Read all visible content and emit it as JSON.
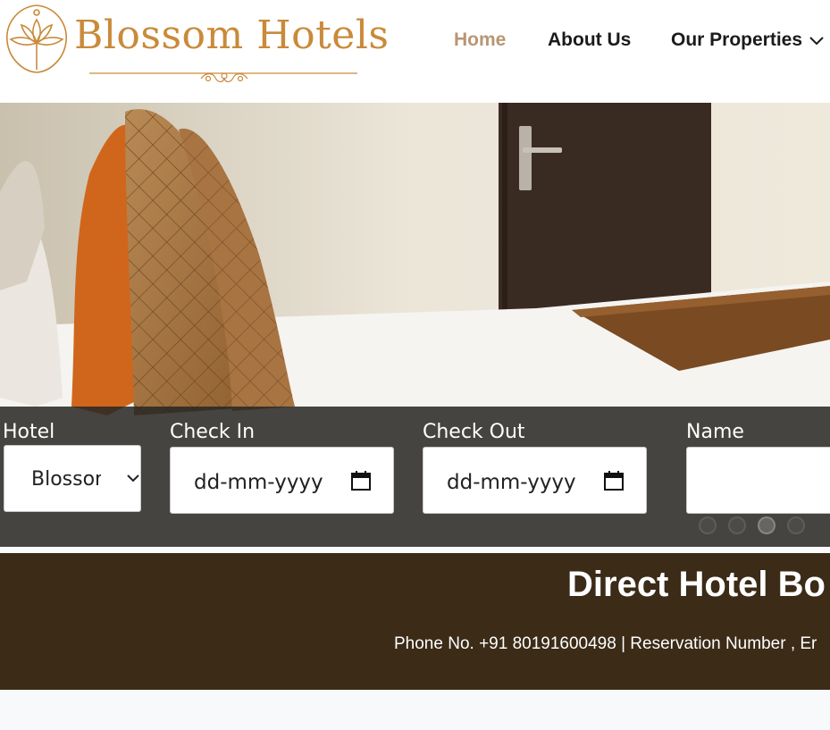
{
  "brand": {
    "name": "Blossom Hotels",
    "accent_color": "#c98a3a",
    "logo_icon": "lotus-icon"
  },
  "nav": {
    "items": [
      {
        "label": "Home",
        "active": true,
        "color": "#b99573"
      },
      {
        "label": "About Us",
        "active": false
      },
      {
        "label": "Our Properties",
        "active": false,
        "has_dropdown": true
      }
    ],
    "dropdown_icon": "chevron-down-icon"
  },
  "hero": {
    "slides_count": 4,
    "active_slide": 3
  },
  "booking": {
    "hotel_label": "Hotel",
    "hotel_selected": "Blossom",
    "checkin_label": "Check In",
    "checkin_value": "dd-mm-yyyy",
    "checkout_label": "Check Out",
    "checkout_value": "dd-mm-yyyy",
    "name_label": "Name",
    "name_value": "",
    "calendar_icon": "calendar-icon"
  },
  "banner": {
    "title": "Direct Hotel Bo",
    "contact": "Phone No. +91 80191600498 | Reservation Number ,  Er",
    "background": "#3b2b17"
  }
}
